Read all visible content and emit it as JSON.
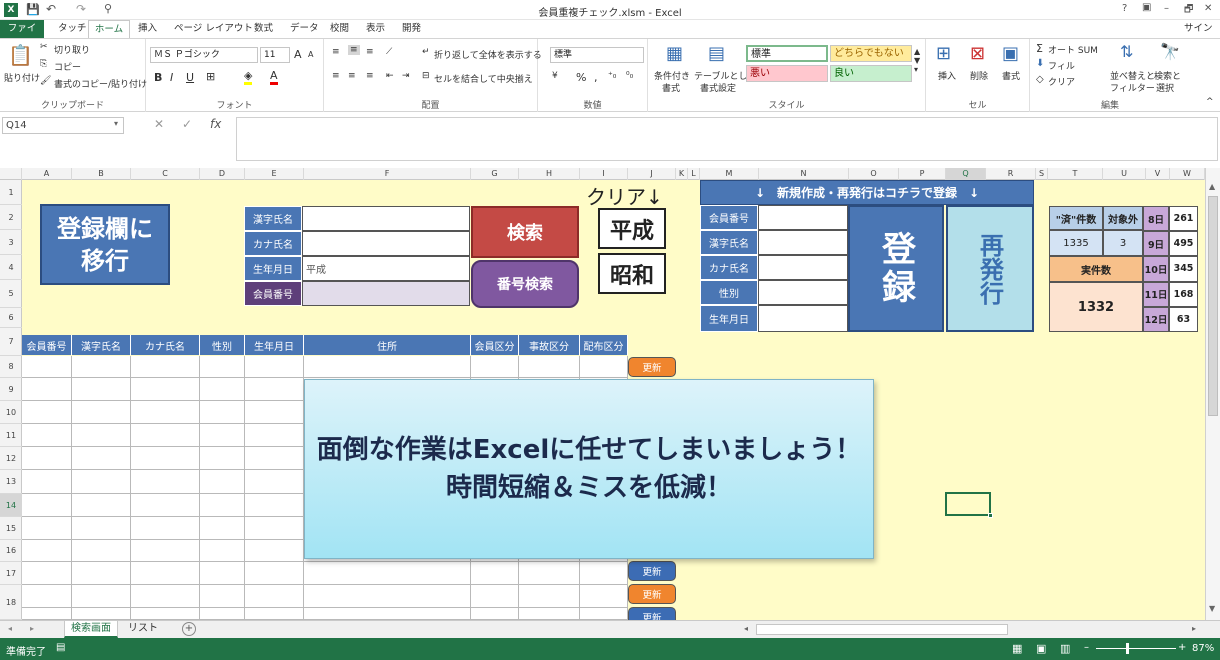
{
  "window": {
    "title": "会員重複チェック.xlsm - Excel",
    "signin": "サインイン",
    "help": "?",
    "min": "–",
    "restore": "🗗",
    "close": "✕"
  },
  "ribbon_tabs": [
    {
      "label": "ファイル"
    },
    {
      "label": "タッチ"
    },
    {
      "label": "ホーム"
    },
    {
      "label": "挿入"
    },
    {
      "label": "ページ レイアウト"
    },
    {
      "label": "数式"
    },
    {
      "label": "データ"
    },
    {
      "label": "校閲"
    },
    {
      "label": "表示"
    },
    {
      "label": "開発"
    }
  ],
  "ribbon": {
    "clipboard": {
      "paste": "貼り付け",
      "cut": "切り取り",
      "copy": "コピー",
      "format_painter": "書式のコピー/貼り付け",
      "group": "クリップボード"
    },
    "font": {
      "name": "ＭＳ Ｐゴシック",
      "size": "11",
      "bold": "B",
      "italic": "I",
      "underline": "U",
      "grow": "A",
      "shrink": "A",
      "group": "フォント"
    },
    "alignment": {
      "wrap": "折り返して全体を表示する",
      "merge": "セルを結合して中央揃え",
      "group": "配置"
    },
    "number": {
      "format": "標準",
      "percent": "%",
      "comma": ",",
      "group": "数値"
    },
    "styles": {
      "conditional": "条件付き",
      "conditional2": "書式",
      "table": "テーブルとして",
      "table2": "書式設定",
      "normal": "標準",
      "neutral": "どちらでもない",
      "bad": "悪い",
      "good": "良い",
      "group": "スタイル"
    },
    "cells": {
      "insert": "挿入",
      "delete": "削除",
      "format": "書式",
      "group": "セル"
    },
    "editing": {
      "autosum": "オート SUM",
      "fill": "フィル",
      "clear": "クリア",
      "sort": "並べ替えと",
      "sort2": "フィルター",
      "find": "検索と",
      "find2": "選択",
      "group": "編集"
    }
  },
  "formula_bar": {
    "name_box": "Q14",
    "fx": "fx"
  },
  "columns": [
    "A",
    "B",
    "C",
    "D",
    "E",
    "F",
    "G",
    "H",
    "I",
    "J",
    "K",
    "L",
    "M",
    "N",
    "O",
    "P",
    "Q",
    "R",
    "S",
    "T",
    "U",
    "V",
    "W"
  ],
  "rows": [
    "1",
    "2",
    "3",
    "4",
    "5",
    "6",
    "7",
    "8",
    "9",
    "10",
    "11",
    "12",
    "13",
    "14",
    "15",
    "16",
    "17",
    "18"
  ],
  "sheet": {
    "goto_register": {
      "line1": "登録欄に",
      "line2": "移行"
    },
    "search_fields": {
      "kanji_name": "漢字氏名",
      "kana_name": "カナ氏名",
      "birth_date": "生年月日",
      "birth_date_value": "平成",
      "member_no": "会員番号"
    },
    "search_button": "検索",
    "number_search_button": "番号検索",
    "clear_label": "クリア↓",
    "heisei_button": "平成",
    "showa_button": "昭和",
    "register_panel": {
      "header": "↓　新規作成・再発行はコチラで登録　↓",
      "member_no": "会員番号",
      "kanji_name": "漢字氏名",
      "kana_name": "カナ氏名",
      "gender": "性別",
      "birth_date": "生年月日",
      "register_button": "登録",
      "reissue_button": "再発行"
    },
    "stats": {
      "done_label": "\"済\"件数",
      "excluded_label": "対象外",
      "done_value": "1335",
      "excluded_value": "3",
      "actual_label": "実件数",
      "actual_value": "1332",
      "days": [
        {
          "day": "8日",
          "count": "261"
        },
        {
          "day": "9日",
          "count": "495"
        },
        {
          "day": "10日",
          "count": "345"
        },
        {
          "day": "11日",
          "count": "168"
        },
        {
          "day": "12日",
          "count": "63"
        }
      ]
    },
    "table_headers": [
      "会員番号",
      "漢字氏名",
      "カナ氏名",
      "性別",
      "生年月日",
      "住所",
      "会員区分",
      "事故区分",
      "配布区分"
    ],
    "update_label": "更新",
    "callout": {
      "line1": "面倒な作業はExcelに任せてしまいましょう！",
      "line2": "時間短縮＆ミスを低減！"
    }
  },
  "sheet_tabs": [
    {
      "label": "検索画面"
    },
    {
      "label": "リスト"
    }
  ],
  "add_sheet": "+",
  "status": {
    "ready": "準備完了",
    "zoom": "87%",
    "minus": "–",
    "plus": "+"
  },
  "colors": {
    "excel_green": "#217346",
    "sheet_bg": "#fffcc8",
    "blue_label": "#4a76b4",
    "red_button": "#c44a45",
    "purple_button": "#8058a0",
    "orange_update": "#f0852e",
    "blue_update": "#3c6cb4"
  }
}
